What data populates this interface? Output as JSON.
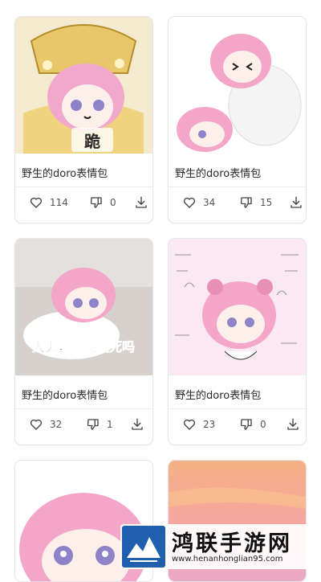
{
  "cards": [
    {
      "title": "野生的doro表情包",
      "caption": "跪",
      "likes": "114",
      "dislikes": "0"
    },
    {
      "title": "野生的doro表情包",
      "caption": "",
      "likes": "34",
      "dislikes": "15"
    },
    {
      "title": "野生的doro表情包",
      "caption": "大夫，我还没死吗",
      "likes": "32",
      "dislikes": "1"
    },
    {
      "title": "野生的doro表情包",
      "caption": "",
      "likes": "23",
      "dislikes": "0"
    },
    {
      "title": "",
      "caption": ""
    },
    {
      "title": "",
      "caption": ""
    }
  ],
  "icons": {
    "like": "heart-outline-icon",
    "dislike": "thumbs-down-icon",
    "download": "download-icon"
  },
  "colors": {
    "accent_pink": "#f3a6c8",
    "text": "#2a2a2a",
    "muted": "#555555",
    "border": "#e6e6ea"
  },
  "watermark": {
    "title": "鸿联手游网",
    "url": "www.henanhonglian95.com"
  }
}
